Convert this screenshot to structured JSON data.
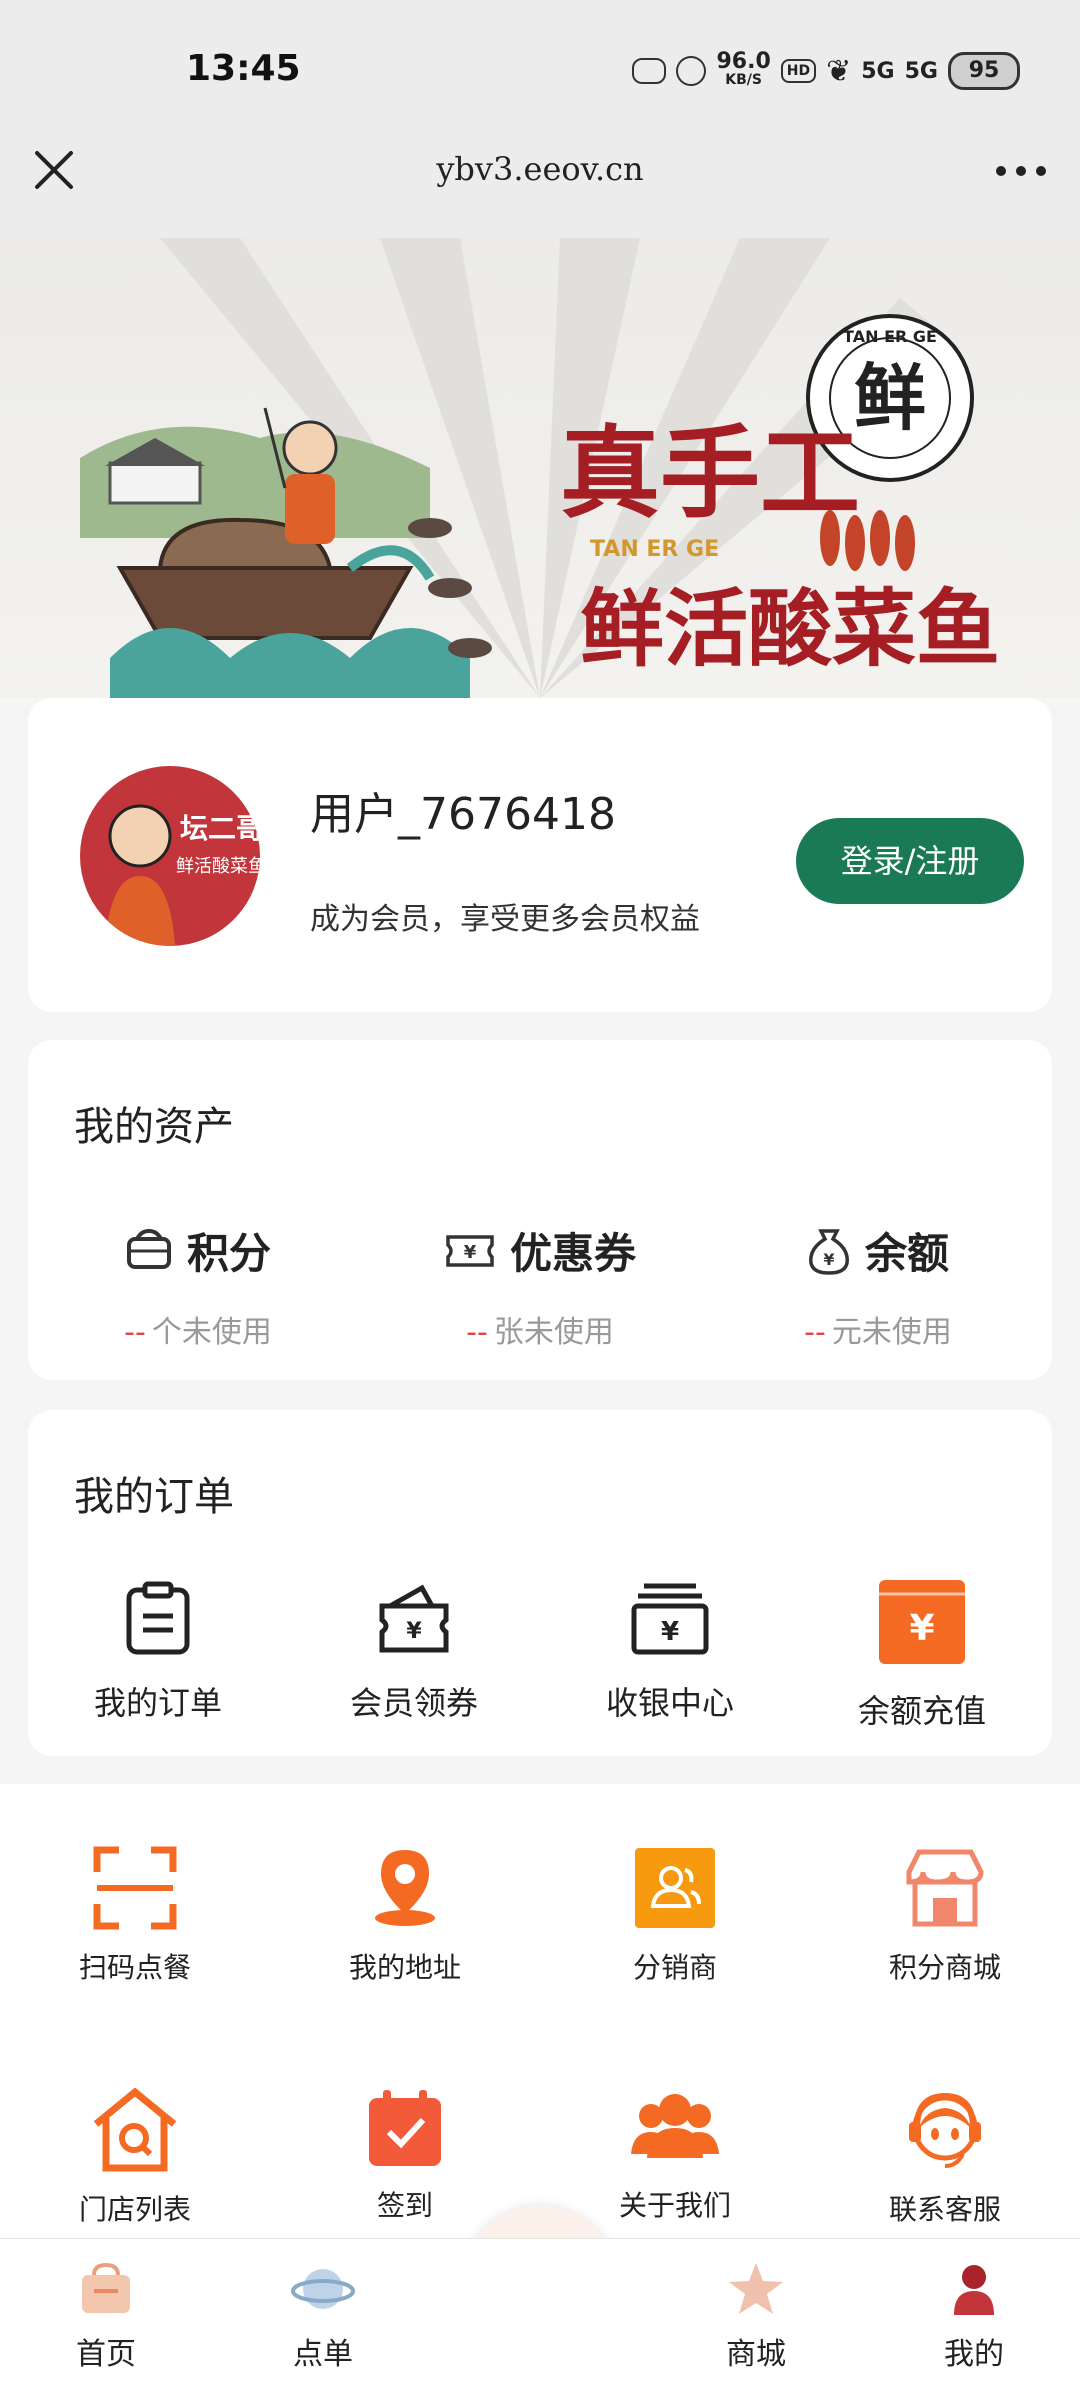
{
  "status_bar": {
    "time": "13:45",
    "net_speed": "96.0",
    "net_unit": "KB/S",
    "hd": "HD",
    "sig1": "5G",
    "sig2": "5G",
    "battery": "95"
  },
  "browser": {
    "url": "ybv3.eeov.cn"
  },
  "banner": {
    "headline_1": "真手工",
    "headline_2": "鲜活酸菜鱼",
    "brand_en": "TAN ER GE",
    "seal_char": "鲜",
    "seal_text": "TAN ER GE"
  },
  "profile": {
    "avatar_brand": "坛二哥",
    "avatar_sub": "鲜活酸菜鱼",
    "username": "用户_7676418",
    "tip": "成为会员，享受更多会员权益",
    "login_label": "登录/注册"
  },
  "assets": {
    "title": "我的资产",
    "items": [
      {
        "label": "积分",
        "dash": "--",
        "sub": "个未使用",
        "icon": "points-wallet-icon"
      },
      {
        "label": "优惠券",
        "dash": "--",
        "sub": "张未使用",
        "icon": "coupon-icon"
      },
      {
        "label": "余额",
        "dash": "--",
        "sub": "元未使用",
        "icon": "money-bag-icon"
      }
    ]
  },
  "orders": {
    "title": "我的订单",
    "items": [
      {
        "label": "我的订单",
        "icon": "clipboard-icon"
      },
      {
        "label": "会员领券",
        "icon": "coupon-wallet-icon"
      },
      {
        "label": "收银中心",
        "icon": "cashier-icon"
      },
      {
        "label": "余额充值",
        "icon": "recharge-icon"
      }
    ]
  },
  "services": [
    {
      "label": "扫码点餐",
      "icon": "scan-icon"
    },
    {
      "label": "我的地址",
      "icon": "location-pin-icon"
    },
    {
      "label": "分销商",
      "icon": "distributor-icon"
    },
    {
      "label": "积分商城",
      "icon": "store-icon"
    },
    {
      "label": "门店列表",
      "icon": "store-search-icon"
    },
    {
      "label": "签到",
      "icon": "calendar-check-icon"
    },
    {
      "label": "关于我们",
      "icon": "people-group-icon"
    },
    {
      "label": "联系客服",
      "icon": "customer-service-icon"
    }
  ],
  "bottom_nav": [
    {
      "label": "首页",
      "icon": "home-icon"
    },
    {
      "label": "点单",
      "icon": "planet-icon"
    },
    {
      "label": "商城",
      "icon": "star-icon"
    },
    {
      "label": "我的",
      "icon": "user-icon"
    }
  ],
  "colors": {
    "accent_orange": "#f46a22",
    "login_green": "#1a7a55",
    "banner_red": "#a51e24",
    "dash_red": "#e04646"
  }
}
